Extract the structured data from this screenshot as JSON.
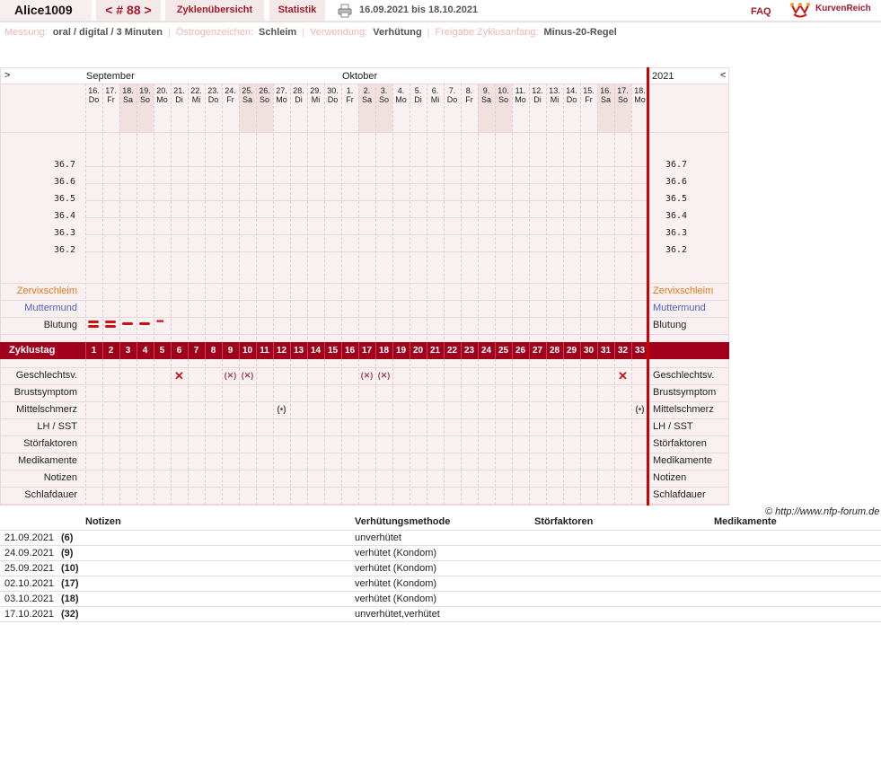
{
  "header": {
    "user": "Alice1009",
    "cycle": "< # 88 >",
    "tab_overview": "Zyklenübersicht",
    "tab_stats": "Statistik",
    "date_range": "16.09.2021 bis 18.10.2021",
    "faq": "FAQ",
    "brand": "KurvenReich"
  },
  "info": [
    {
      "label": "Messung:",
      "value": "oral / digital / 3 Minuten"
    },
    {
      "label": "Östrogenzeichen:",
      "value": "Schleim"
    },
    {
      "label": "Verwendung:",
      "value": "Verhütung"
    },
    {
      "label": "Freigabe Zyklusanfang:",
      "value": "Minus-20-Regel"
    }
  ],
  "chart": {
    "nav_left": ">",
    "nav_right": "<",
    "year": "2021",
    "months": [
      {
        "name": "September",
        "start": 0
      },
      {
        "name": "Oktober",
        "start": 15
      }
    ],
    "days": [
      {
        "d": "16.",
        "w": "Do"
      },
      {
        "d": "17.",
        "w": "Fr"
      },
      {
        "d": "18.",
        "w": "Sa"
      },
      {
        "d": "19.",
        "w": "So"
      },
      {
        "d": "20.",
        "w": "Mo"
      },
      {
        "d": "21.",
        "w": "Di"
      },
      {
        "d": "22.",
        "w": "Mi"
      },
      {
        "d": "23.",
        "w": "Do"
      },
      {
        "d": "24.",
        "w": "Fr"
      },
      {
        "d": "25.",
        "w": "Sa"
      },
      {
        "d": "26.",
        "w": "So"
      },
      {
        "d": "27.",
        "w": "Mo"
      },
      {
        "d": "28.",
        "w": "Di"
      },
      {
        "d": "29.",
        "w": "Mi"
      },
      {
        "d": "30.",
        "w": "Do"
      },
      {
        "d": "1.",
        "w": "Fr"
      },
      {
        "d": "2.",
        "w": "Sa"
      },
      {
        "d": "3.",
        "w": "So"
      },
      {
        "d": "4.",
        "w": "Mo"
      },
      {
        "d": "5.",
        "w": "Di"
      },
      {
        "d": "6.",
        "w": "Mi"
      },
      {
        "d": "7.",
        "w": "Do"
      },
      {
        "d": "8.",
        "w": "Fr"
      },
      {
        "d": "9.",
        "w": "Sa"
      },
      {
        "d": "10.",
        "w": "So"
      },
      {
        "d": "11.",
        "w": "Mo"
      },
      {
        "d": "12.",
        "w": "Di"
      },
      {
        "d": "13.",
        "w": "Mi"
      },
      {
        "d": "14.",
        "w": "Do"
      },
      {
        "d": "15.",
        "w": "Fr"
      },
      {
        "d": "16.",
        "w": "Sa"
      },
      {
        "d": "17.",
        "w": "So"
      },
      {
        "d": "18.",
        "w": "Mo"
      }
    ],
    "temp_ticks": [
      "36.7",
      "36.6",
      "36.5",
      "36.4",
      "36.3",
      "36.2"
    ],
    "rows_top": [
      {
        "label": "Zervixschleim",
        "color": "#e07818"
      },
      {
        "label": "Muttermund",
        "color": "#5060c0"
      },
      {
        "label": "Blutung",
        "color": "#222222"
      }
    ],
    "cycle_label": "Zyklustag",
    "cycle_days": [
      "1",
      "2",
      "3",
      "4",
      "5",
      "6",
      "7",
      "8",
      "9",
      "10",
      "11",
      "12",
      "13",
      "14",
      "15",
      "16",
      "17",
      "18",
      "19",
      "20",
      "21",
      "22",
      "23",
      "24",
      "25",
      "26",
      "27",
      "28",
      "29",
      "30",
      "31",
      "32",
      "33"
    ],
    "rows_bottom": [
      "Geschlechtsv.",
      "Brustsymptom",
      "Mittelschmerz",
      "LH / SST",
      "Störfaktoren",
      "Medikamente",
      "Notizen",
      "Schlafdauer"
    ],
    "bleeding": [
      {
        "day": 1,
        "level": "heavy"
      },
      {
        "day": 2,
        "level": "heavy"
      },
      {
        "day": 3,
        "level": "medium"
      },
      {
        "day": 4,
        "level": "medium"
      },
      {
        "day": 5,
        "level": "spotting"
      }
    ],
    "intercourse": [
      {
        "day": 6,
        "symbol": "✕"
      },
      {
        "day": 9,
        "symbol": "(✕)"
      },
      {
        "day": 10,
        "symbol": "(✕)"
      },
      {
        "day": 17,
        "symbol": "(✕)"
      },
      {
        "day": 18,
        "symbol": "(✕)"
      },
      {
        "day": 32,
        "symbol": "✕"
      }
    ],
    "mittelschmerz": [
      {
        "day": 12,
        "symbol": "(•)"
      },
      {
        "day": 33,
        "symbol": "(•)"
      }
    ]
  },
  "copyright": "© http://www.nfp-forum.de",
  "notes_table": {
    "headers": [
      "Notizen",
      "Verhütungsmethode",
      "Störfaktoren",
      "Medikamente"
    ],
    "rows": [
      {
        "date": "21.09.2021",
        "day": "(6)",
        "method": "unverhütet"
      },
      {
        "date": "24.09.2021",
        "day": "(9)",
        "method": "verhütet (Kondom)"
      },
      {
        "date": "25.09.2021",
        "day": "(10)",
        "method": "verhütet (Kondom)"
      },
      {
        "date": "02.10.2021",
        "day": "(17)",
        "method": "verhütet (Kondom)"
      },
      {
        "date": "03.10.2021",
        "day": "(18)",
        "method": "verhütet (Kondom)"
      },
      {
        "date": "17.10.2021",
        "day": "(32)",
        "method": "unverhütet,verhütet"
      }
    ]
  }
}
